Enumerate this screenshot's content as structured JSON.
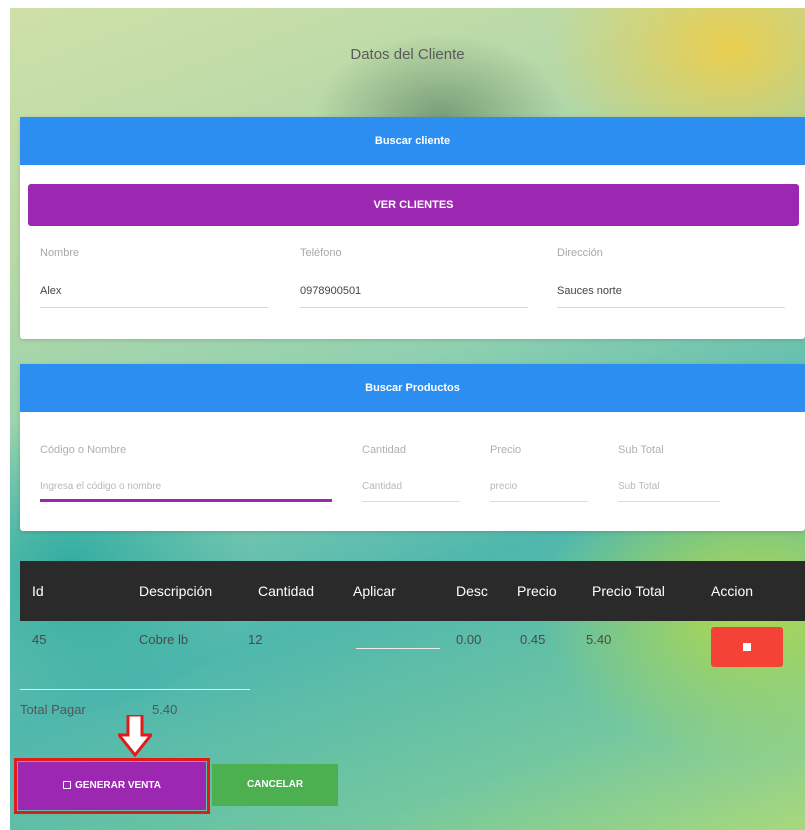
{
  "page": {
    "title": "Datos del Cliente"
  },
  "cliente": {
    "header": "Buscar cliente",
    "ver_clientes_label": "VER CLIENTES",
    "fields": [
      {
        "label": "Nombre",
        "value": "Alex"
      },
      {
        "label": "Teléfono",
        "value": "0978900501"
      },
      {
        "label": "Dirección",
        "value": "Sauces norte"
      }
    ]
  },
  "productos": {
    "header": "Buscar Productos",
    "codigo_label": "Código o Nombre",
    "codigo_placeholder": "Ingresa el código o nombre",
    "cantidad_label": "Cantidad",
    "cantidad_placeholder": "Cantidad",
    "precio_label": "Precio",
    "precio_placeholder": "precio",
    "subtotal_label": "Sub Total",
    "subtotal_placeholder": "Sub Total"
  },
  "table": {
    "headers": [
      "Id",
      "Descripción",
      "Cantidad",
      "Aplicar",
      "Desc",
      "Precio",
      "Precio Total",
      "Accion"
    ],
    "rows": [
      {
        "id": "45",
        "descripcion": "Cobre lb",
        "cantidad": "12",
        "desc": "0.00",
        "precio": "0.45",
        "precio_total": "5.40"
      }
    ]
  },
  "total": {
    "label": "Total Pagar",
    "value": "5.40"
  },
  "actions": {
    "generar_label": "GENERAR VENTA",
    "cancelar_label": "CANCELAR"
  },
  "colors": {
    "accent_blue": "#2b8ef0",
    "accent_purple": "#9c27b0",
    "danger": "#f44336",
    "success": "#4caf50",
    "highlight": "#e01b1b"
  },
  "icons": [
    "save-icon",
    "delete-icon",
    "down-arrow-icon"
  ]
}
